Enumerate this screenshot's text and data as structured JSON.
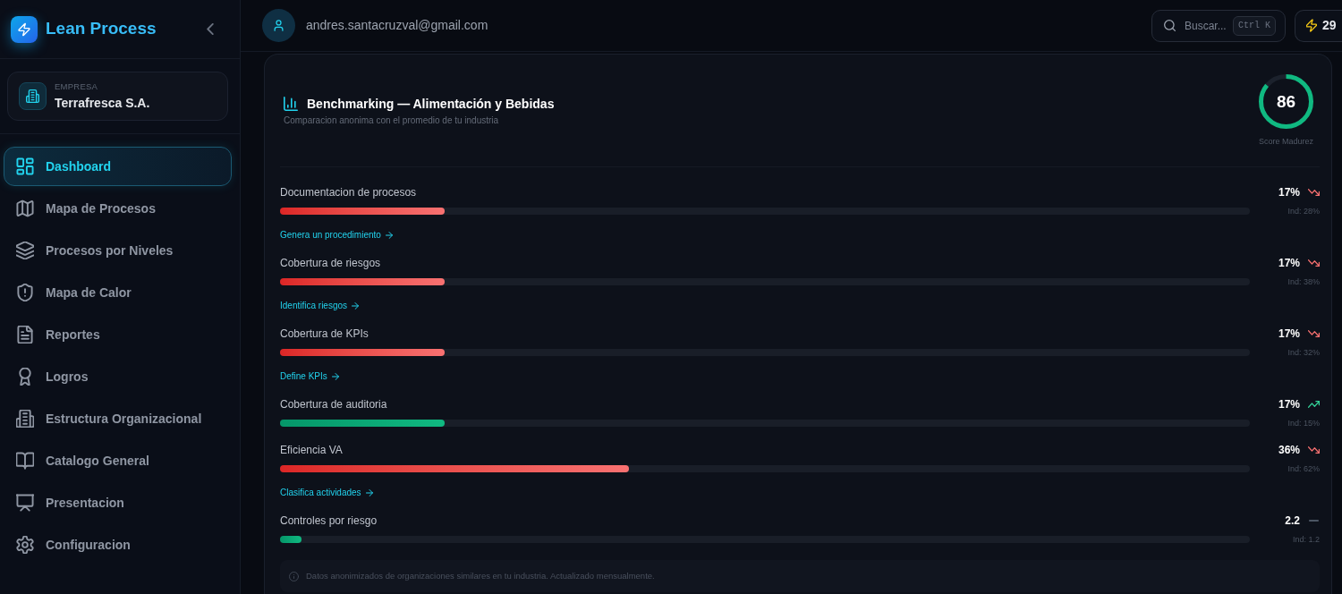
{
  "sidebar": {
    "brand": "Lean Process",
    "company": {
      "label": "EMPRESA",
      "name": "Terrafresca S.A."
    },
    "items": [
      {
        "label": "Dashboard",
        "selected": true
      },
      {
        "label": "Mapa de Procesos",
        "selected": false
      },
      {
        "label": "Procesos por Niveles",
        "selected": false
      },
      {
        "label": "Mapa de Calor",
        "selected": false
      },
      {
        "label": "Reportes",
        "selected": false
      },
      {
        "label": "Logros",
        "selected": false
      },
      {
        "label": "Estructura Organizacional",
        "selected": false
      },
      {
        "label": "Catalogo General",
        "selected": false
      },
      {
        "label": "Presentacion",
        "selected": false
      },
      {
        "label": "Configuracion",
        "selected": false
      }
    ]
  },
  "header": {
    "user_email": "andres.santacruzval@gmail.com",
    "search": {
      "placeholder": "Buscar...",
      "shortcut": "Ctrl K"
    },
    "streak": "29"
  },
  "benchmark": {
    "title": "Benchmarking — Alimentación y Bebidas",
    "subtitle": "Comparacion anonima con el promedio de tu industria",
    "score": {
      "value": "86",
      "label": "Score Madurez",
      "level": 0.86
    },
    "metrics": [
      {
        "kind": "declining",
        "label": "Documentacion de procesos",
        "value": "17%",
        "industry": "Ind: 28%",
        "level": 0.17,
        "action": "Genera un procedimiento"
      },
      {
        "kind": "declining",
        "label": "Cobertura de riesgos",
        "value": "17%",
        "industry": "Ind: 38%",
        "level": 0.17,
        "action": "Identifica riesgos"
      },
      {
        "kind": "declining",
        "label": "Cobertura de KPIs",
        "value": "17%",
        "industry": "Ind: 32%",
        "level": 0.17,
        "action": "Define KPIs"
      },
      {
        "kind": "improving",
        "label": "Cobertura de auditoria",
        "value": "17%",
        "industry": "Ind: 15%",
        "level": 0.17
      },
      {
        "kind": "declining",
        "label": "Eficiencia VA",
        "value": "36%",
        "industry": "Ind: 62%",
        "level": 0.36,
        "action": "Clasifica actividades"
      },
      {
        "kind": "steady",
        "label": "Controles por riesgo",
        "value": "2.2",
        "industry": "Ind: 1.2",
        "level": 0.022
      }
    ],
    "note": "Datos anonimizados de organizaciones similares en tu industria. Actualizado mensualmente."
  }
}
